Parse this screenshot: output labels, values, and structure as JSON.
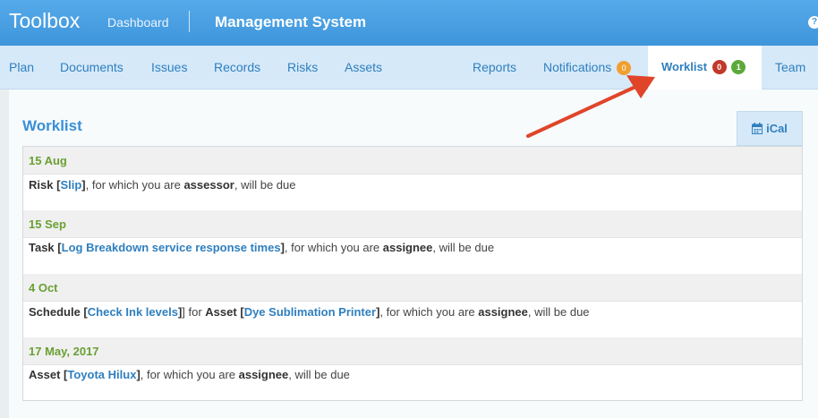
{
  "topbar": {
    "brand": "Toolbox",
    "dashboard": "Dashboard",
    "system": "Management System"
  },
  "nav": {
    "plan": "Plan",
    "documents": "Documents",
    "issues": "Issues",
    "records": "Records",
    "risks": "Risks",
    "assets": "Assets",
    "reports": "Reports",
    "notifications": "Notifications",
    "notifications_count": "0",
    "worklist": "Worklist",
    "worklist_red": "0",
    "worklist_green": "1",
    "team": "Team"
  },
  "page": {
    "title": "Worklist",
    "ical": "iCal"
  },
  "colors": {
    "accent": "#3a8fd8",
    "date": "#6aa033",
    "arrow": "#e0452a"
  },
  "entries": [
    {
      "date": "15 Aug",
      "type": "Risk",
      "link": "Slip",
      "after_link": "], for which you are ",
      "role": "assessor",
      "tail": ", will be due"
    },
    {
      "date": "15 Sep",
      "type": "Task",
      "link": "Log Breakdown service response times",
      "after_link": "], for which you are ",
      "role": "assignee",
      "tail": ", will be due"
    },
    {
      "date": "4 Oct",
      "type": "Schedule",
      "link": "Check Ink levels",
      "mid1": "] for ",
      "asset_label": "Asset",
      "link2": "Dye Sublimation Printer",
      "after_link": "], for which you are ",
      "role": "assignee",
      "tail": ", will be due"
    },
    {
      "date": "17 May, 2017",
      "type": "Asset",
      "link": "Toyota Hilux",
      "after_link": "], for which you are ",
      "role": "assignee",
      "tail": ", will be due"
    }
  ]
}
